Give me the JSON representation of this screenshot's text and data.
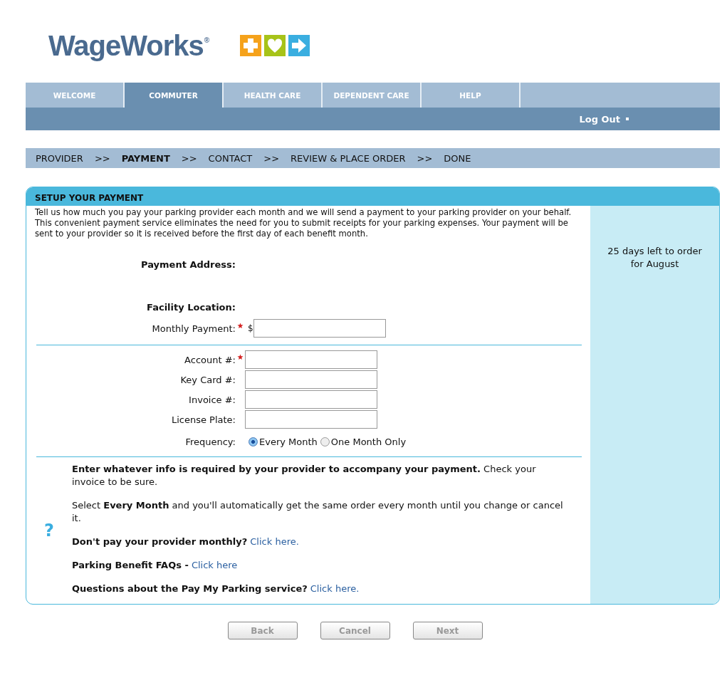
{
  "logo": {
    "name": "WageWorks",
    "mark": "®"
  },
  "tabs": [
    {
      "label": "WELCOME",
      "selected": false
    },
    {
      "label": "COMMUTER",
      "selected": true
    },
    {
      "label": "HEALTH CARE",
      "selected": false
    },
    {
      "label": "DEPENDENT CARE",
      "selected": false
    },
    {
      "label": "HELP",
      "selected": false
    }
  ],
  "logout": "Log Out",
  "steps": [
    {
      "label": "PROVIDER",
      "selected": false
    },
    {
      "label": "PAYMENT",
      "selected": true
    },
    {
      "label": "CONTACT",
      "selected": false
    },
    {
      "label": "REVIEW & PLACE ORDER",
      "selected": false
    },
    {
      "label": "DONE",
      "selected": false
    }
  ],
  "step_separator": ">>",
  "panel": {
    "title": "SETUP YOUR PAYMENT",
    "intro": "Tell us how much you pay your parking provider each month and we will send a payment to your parking provider on your behalf. This convenient payment service eliminates the need for you to submit receipts for your parking expenses. Your payment will be sent to your provider so it is received before the first day of each benefit month.",
    "sidebar": "25 days left to order for August",
    "section_1": [
      {
        "kind": "heading",
        "label": "Payment Address:"
      },
      {
        "kind": "heading",
        "label": "Facility Location:"
      },
      {
        "kind": "field",
        "label": "Monthly Payment:",
        "required": true,
        "prefix": "$"
      }
    ],
    "section_2": [
      {
        "kind": "field",
        "label": "Account #:",
        "required": true
      },
      {
        "kind": "field",
        "label": "Key Card #:",
        "required": false
      },
      {
        "kind": "field",
        "label": "Invoice #:",
        "required": false
      },
      {
        "kind": "field",
        "label": "License Plate:",
        "required": false
      }
    ],
    "frequency": {
      "label": "Frequency:",
      "options": [
        {
          "label": "Every Month",
          "selected": true
        },
        {
          "label": "One Month Only",
          "selected": false
        }
      ]
    },
    "help_icon": "?",
    "help": [
      {
        "text": "**Enter whatever info is required by your provider to accompany your payment.** Check your invoice to be sure."
      },
      {
        "text": "Select **Every Month** and you'll automatically get the same order every month until you change or cancel it."
      },
      {
        "text": "**Don't pay your provider monthly?**",
        "link": "Click here."
      },
      {
        "text": "**Parking Benefit FAQs -**",
        "link": "Click here"
      },
      {
        "text": "**Questions about the Pay My Parking service?**",
        "link": "Click here."
      }
    ]
  },
  "buttons": [
    {
      "label": "Back",
      "disabled": true
    },
    {
      "label": "Cancel",
      "disabled": true
    },
    {
      "label": "Next",
      "disabled": true
    }
  ]
}
